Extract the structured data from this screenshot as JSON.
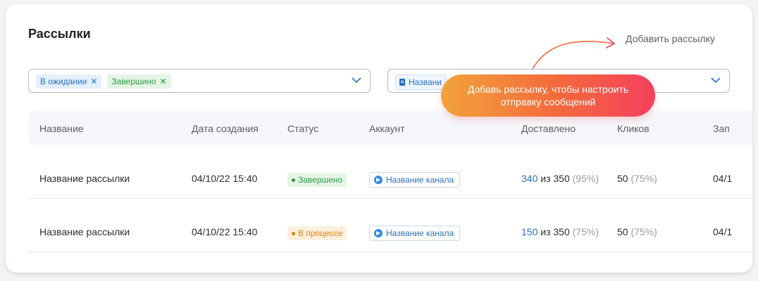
{
  "page": {
    "title": "Рассылки",
    "add_button": "Добавить рассылку"
  },
  "filters": {
    "status_chips": [
      {
        "label": "В ожидании",
        "remove": "✕"
      },
      {
        "label": "Завершино",
        "remove": "✕"
      }
    ],
    "account_chip": "Названи"
  },
  "tooltip": {
    "line1": "Добавь рассылку, чтобы настроить",
    "line2": "отправку сообщений"
  },
  "table": {
    "headers": [
      "Название",
      "Дата создания",
      "Статус",
      "Аккаунт",
      "Доставлено",
      "Кликов",
      "Зап"
    ],
    "rows": [
      {
        "name": "Название рассылки",
        "date": "04/10/22 15:40",
        "status": "Завершено",
        "account": "Название канала",
        "delivered": "340",
        "delivered_of": "из 350",
        "delivered_pct": "(95%)",
        "clicks": "50",
        "clicks_pct": "(75%)",
        "sched": "04/1"
      },
      {
        "name": "Название рассылки",
        "date": "04/10/22 15:40",
        "status": "В процессе",
        "account": "Название канала",
        "delivered": "150",
        "delivered_of": "из 350",
        "delivered_pct": "(75%)",
        "clicks": "50",
        "clicks_pct": "(75%)",
        "sched": "04/1"
      }
    ]
  },
  "colors": {
    "accent_blue": "#2a6fbf",
    "status_done": "#2f9a43",
    "status_process": "#e57f14",
    "tooltip_gradient_start": "#f2a33b",
    "tooltip_gradient_end": "#f43f5e"
  }
}
